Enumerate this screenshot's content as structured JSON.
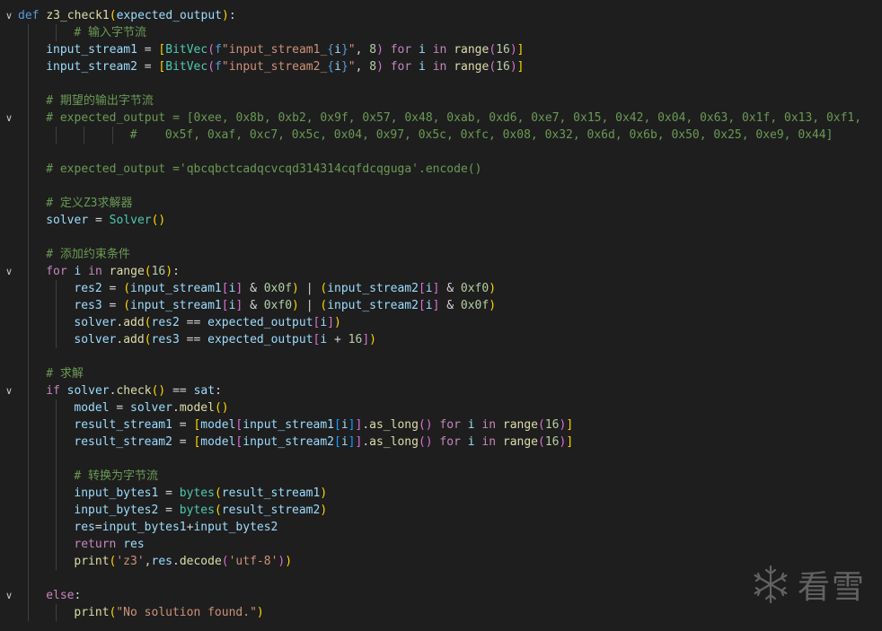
{
  "editor": {
    "language": "python",
    "theme_colors": {
      "background": "#1e1e1e",
      "keyword": "#569cd6",
      "control": "#c586c0",
      "function": "#dcdcaa",
      "class": "#4ec9b0",
      "variable": "#9cdcfe",
      "string": "#ce9178",
      "number": "#b5cea8",
      "comment": "#6a9955"
    },
    "lines": [
      {
        "fold": true,
        "guides": 0,
        "indent": 0,
        "tokens": [
          [
            "kw",
            "def "
          ],
          [
            "fn",
            "z3_check1"
          ],
          [
            "b1",
            "("
          ],
          [
            "var",
            "expected_output"
          ],
          [
            "b1",
            ")"
          ],
          [
            "op",
            ":"
          ]
        ]
      },
      {
        "fold": false,
        "guides": 2,
        "indent": 8,
        "tokens": [
          [
            "cmt",
            "# 输入字节流"
          ]
        ]
      },
      {
        "fold": false,
        "guides": 1,
        "indent": 4,
        "tokens": [
          [
            "var",
            "input_stream1"
          ],
          [
            "op",
            " = "
          ],
          [
            "b1",
            "["
          ],
          [
            "cls",
            "BitVec"
          ],
          [
            "b2",
            "("
          ],
          [
            "fstr",
            "f"
          ],
          [
            "str",
            "\"input_stream1_"
          ],
          [
            "kw",
            "{"
          ],
          [
            "var",
            "i"
          ],
          [
            "kw",
            "}"
          ],
          [
            "str",
            "\""
          ],
          [
            "op",
            ", "
          ],
          [
            "num",
            "8"
          ],
          [
            "b2",
            ")"
          ],
          [
            "ctl",
            " for "
          ],
          [
            "var",
            "i"
          ],
          [
            "ctl",
            " in "
          ],
          [
            "fn",
            "range"
          ],
          [
            "b2",
            "("
          ],
          [
            "num",
            "16"
          ],
          [
            "b2",
            ")"
          ],
          [
            "b1",
            "]"
          ]
        ]
      },
      {
        "fold": false,
        "guides": 1,
        "indent": 4,
        "tokens": [
          [
            "var",
            "input_stream2"
          ],
          [
            "op",
            " = "
          ],
          [
            "b1",
            "["
          ],
          [
            "cls",
            "BitVec"
          ],
          [
            "b2",
            "("
          ],
          [
            "fstr",
            "f"
          ],
          [
            "str",
            "\"input_stream2_"
          ],
          [
            "kw",
            "{"
          ],
          [
            "var",
            "i"
          ],
          [
            "kw",
            "}"
          ],
          [
            "str",
            "\""
          ],
          [
            "op",
            ", "
          ],
          [
            "num",
            "8"
          ],
          [
            "b2",
            ")"
          ],
          [
            "ctl",
            " for "
          ],
          [
            "var",
            "i"
          ],
          [
            "ctl",
            " in "
          ],
          [
            "fn",
            "range"
          ],
          [
            "b2",
            "("
          ],
          [
            "num",
            "16"
          ],
          [
            "b2",
            ")"
          ],
          [
            "b1",
            "]"
          ]
        ]
      },
      {
        "fold": false,
        "guides": 1,
        "indent": 0,
        "tokens": []
      },
      {
        "fold": false,
        "guides": 1,
        "indent": 4,
        "tokens": [
          [
            "cmt",
            "# 期望的输出字节流"
          ]
        ]
      },
      {
        "fold": true,
        "guides": 1,
        "indent": 4,
        "tokens": [
          [
            "cmt",
            "# expected_output = [0xee, 0x8b, 0xb2, 0x9f, 0x57, 0x48, 0xab, 0xd6, 0xe7, 0x15, 0x42, 0x04, 0x63, 0x1f, 0x13, 0xf1,"
          ]
        ]
      },
      {
        "fold": false,
        "guides": 4,
        "indent": 16,
        "tokens": [
          [
            "cmt",
            "#    0x5f, 0xaf, 0xc7, 0x5c, 0x04, 0x97, 0x5c, 0xfc, 0x08, 0x32, 0x6d, 0x6b, 0x50, 0x25, 0xe9, 0x44]"
          ]
        ]
      },
      {
        "fold": false,
        "guides": 1,
        "indent": 0,
        "tokens": []
      },
      {
        "fold": false,
        "guides": 1,
        "indent": 4,
        "tokens": [
          [
            "cmt",
            "# expected_output ='qbcqbctcadqcvcqd314314cqfdcqguga'.encode()"
          ]
        ]
      },
      {
        "fold": false,
        "guides": 1,
        "indent": 0,
        "tokens": []
      },
      {
        "fold": false,
        "guides": 1,
        "indent": 4,
        "tokens": [
          [
            "cmt",
            "# 定义Z3求解器"
          ]
        ]
      },
      {
        "fold": false,
        "guides": 1,
        "indent": 4,
        "tokens": [
          [
            "var",
            "solver"
          ],
          [
            "op",
            " = "
          ],
          [
            "cls",
            "Solver"
          ],
          [
            "b1",
            "()"
          ]
        ]
      },
      {
        "fold": false,
        "guides": 1,
        "indent": 0,
        "tokens": []
      },
      {
        "fold": false,
        "guides": 1,
        "indent": 4,
        "tokens": [
          [
            "cmt",
            "# 添加约束条件"
          ]
        ]
      },
      {
        "fold": true,
        "guides": 1,
        "indent": 4,
        "tokens": [
          [
            "ctl",
            "for "
          ],
          [
            "var",
            "i"
          ],
          [
            "ctl",
            " in "
          ],
          [
            "fn",
            "range"
          ],
          [
            "b1",
            "("
          ],
          [
            "num",
            "16"
          ],
          [
            "b1",
            ")"
          ],
          [
            "op",
            ":"
          ]
        ]
      },
      {
        "fold": false,
        "guides": 2,
        "indent": 8,
        "tokens": [
          [
            "var",
            "res2"
          ],
          [
            "op",
            " = "
          ],
          [
            "b1",
            "("
          ],
          [
            "var",
            "input_stream1"
          ],
          [
            "b2",
            "["
          ],
          [
            "var",
            "i"
          ],
          [
            "b2",
            "]"
          ],
          [
            "op",
            " & "
          ],
          [
            "num",
            "0x0f"
          ],
          [
            "b1",
            ")"
          ],
          [
            "op",
            " | "
          ],
          [
            "b1",
            "("
          ],
          [
            "var",
            "input_stream2"
          ],
          [
            "b2",
            "["
          ],
          [
            "var",
            "i"
          ],
          [
            "b2",
            "]"
          ],
          [
            "op",
            " & "
          ],
          [
            "num",
            "0xf0"
          ],
          [
            "b1",
            ")"
          ]
        ]
      },
      {
        "fold": false,
        "guides": 2,
        "indent": 8,
        "tokens": [
          [
            "var",
            "res3"
          ],
          [
            "op",
            " = "
          ],
          [
            "b1",
            "("
          ],
          [
            "var",
            "input_stream1"
          ],
          [
            "b2",
            "["
          ],
          [
            "var",
            "i"
          ],
          [
            "b2",
            "]"
          ],
          [
            "op",
            " & "
          ],
          [
            "num",
            "0xf0"
          ],
          [
            "b1",
            ")"
          ],
          [
            "op",
            " | "
          ],
          [
            "b1",
            "("
          ],
          [
            "var",
            "input_stream2"
          ],
          [
            "b2",
            "["
          ],
          [
            "var",
            "i"
          ],
          [
            "b2",
            "]"
          ],
          [
            "op",
            " & "
          ],
          [
            "num",
            "0x0f"
          ],
          [
            "b1",
            ")"
          ]
        ]
      },
      {
        "fold": false,
        "guides": 2,
        "indent": 8,
        "tokens": [
          [
            "var",
            "solver"
          ],
          [
            "op",
            "."
          ],
          [
            "fn",
            "add"
          ],
          [
            "b1",
            "("
          ],
          [
            "var",
            "res2"
          ],
          [
            "op",
            " == "
          ],
          [
            "var",
            "expected_output"
          ],
          [
            "b2",
            "["
          ],
          [
            "var",
            "i"
          ],
          [
            "b2",
            "]"
          ],
          [
            "b1",
            ")"
          ]
        ]
      },
      {
        "fold": false,
        "guides": 2,
        "indent": 8,
        "tokens": [
          [
            "var",
            "solver"
          ],
          [
            "op",
            "."
          ],
          [
            "fn",
            "add"
          ],
          [
            "b1",
            "("
          ],
          [
            "var",
            "res3"
          ],
          [
            "op",
            " == "
          ],
          [
            "var",
            "expected_output"
          ],
          [
            "b2",
            "["
          ],
          [
            "var",
            "i"
          ],
          [
            "op",
            " + "
          ],
          [
            "num",
            "16"
          ],
          [
            "b2",
            "]"
          ],
          [
            "b1",
            ")"
          ]
        ]
      },
      {
        "fold": false,
        "guides": 1,
        "indent": 0,
        "tokens": []
      },
      {
        "fold": false,
        "guides": 1,
        "indent": 4,
        "tokens": [
          [
            "cmt",
            "# 求解"
          ]
        ]
      },
      {
        "fold": true,
        "guides": 1,
        "indent": 4,
        "tokens": [
          [
            "ctl",
            "if "
          ],
          [
            "var",
            "solver"
          ],
          [
            "op",
            "."
          ],
          [
            "fn",
            "check"
          ],
          [
            "b1",
            "()"
          ],
          [
            "op",
            " == "
          ],
          [
            "var",
            "sat"
          ],
          [
            "op",
            ":"
          ]
        ]
      },
      {
        "fold": false,
        "guides": 2,
        "indent": 8,
        "tokens": [
          [
            "var",
            "model"
          ],
          [
            "op",
            " = "
          ],
          [
            "var",
            "solver"
          ],
          [
            "op",
            "."
          ],
          [
            "fn",
            "model"
          ],
          [
            "b1",
            "()"
          ]
        ]
      },
      {
        "fold": false,
        "guides": 2,
        "indent": 8,
        "tokens": [
          [
            "var",
            "result_stream1"
          ],
          [
            "op",
            " = "
          ],
          [
            "b1",
            "["
          ],
          [
            "var",
            "model"
          ],
          [
            "b2",
            "["
          ],
          [
            "var",
            "input_stream1"
          ],
          [
            "b3",
            "["
          ],
          [
            "var",
            "i"
          ],
          [
            "b3",
            "]"
          ],
          [
            "b2",
            "]"
          ],
          [
            "op",
            "."
          ],
          [
            "fn",
            "as_long"
          ],
          [
            "b2",
            "()"
          ],
          [
            "ctl",
            " for "
          ],
          [
            "var",
            "i"
          ],
          [
            "ctl",
            " in "
          ],
          [
            "fn",
            "range"
          ],
          [
            "b2",
            "("
          ],
          [
            "num",
            "16"
          ],
          [
            "b2",
            ")"
          ],
          [
            "b1",
            "]"
          ]
        ]
      },
      {
        "fold": false,
        "guides": 2,
        "indent": 8,
        "tokens": [
          [
            "var",
            "result_stream2"
          ],
          [
            "op",
            " = "
          ],
          [
            "b1",
            "["
          ],
          [
            "var",
            "model"
          ],
          [
            "b2",
            "["
          ],
          [
            "var",
            "input_stream2"
          ],
          [
            "b3",
            "["
          ],
          [
            "var",
            "i"
          ],
          [
            "b3",
            "]"
          ],
          [
            "b2",
            "]"
          ],
          [
            "op",
            "."
          ],
          [
            "fn",
            "as_long"
          ],
          [
            "b2",
            "()"
          ],
          [
            "ctl",
            " for "
          ],
          [
            "var",
            "i"
          ],
          [
            "ctl",
            " in "
          ],
          [
            "fn",
            "range"
          ],
          [
            "b2",
            "("
          ],
          [
            "num",
            "16"
          ],
          [
            "b2",
            ")"
          ],
          [
            "b1",
            "]"
          ]
        ]
      },
      {
        "fold": false,
        "guides": 2,
        "indent": 0,
        "tokens": []
      },
      {
        "fold": false,
        "guides": 2,
        "indent": 8,
        "tokens": [
          [
            "cmt",
            "# 转换为字节流"
          ]
        ]
      },
      {
        "fold": false,
        "guides": 2,
        "indent": 8,
        "tokens": [
          [
            "var",
            "input_bytes1"
          ],
          [
            "op",
            " = "
          ],
          [
            "cls",
            "bytes"
          ],
          [
            "b1",
            "("
          ],
          [
            "var",
            "result_stream1"
          ],
          [
            "b1",
            ")"
          ]
        ]
      },
      {
        "fold": false,
        "guides": 2,
        "indent": 8,
        "tokens": [
          [
            "var",
            "input_bytes2"
          ],
          [
            "op",
            " = "
          ],
          [
            "cls",
            "bytes"
          ],
          [
            "b1",
            "("
          ],
          [
            "var",
            "result_stream2"
          ],
          [
            "b1",
            ")"
          ]
        ]
      },
      {
        "fold": false,
        "guides": 2,
        "indent": 8,
        "tokens": [
          [
            "var",
            "res"
          ],
          [
            "op",
            "="
          ],
          [
            "var",
            "input_bytes1"
          ],
          [
            "op",
            "+"
          ],
          [
            "var",
            "input_bytes2"
          ]
        ]
      },
      {
        "fold": false,
        "guides": 2,
        "indent": 8,
        "tokens": [
          [
            "ctl",
            "return "
          ],
          [
            "var",
            "res"
          ]
        ]
      },
      {
        "fold": false,
        "guides": 2,
        "indent": 8,
        "tokens": [
          [
            "fn",
            "print"
          ],
          [
            "b1",
            "("
          ],
          [
            "str",
            "'z3'"
          ],
          [
            "op",
            ","
          ],
          [
            "var",
            "res"
          ],
          [
            "op",
            "."
          ],
          [
            "fn",
            "decode"
          ],
          [
            "b2",
            "("
          ],
          [
            "str",
            "'utf-8'"
          ],
          [
            "b2",
            ")"
          ],
          [
            "b1",
            ")"
          ]
        ]
      },
      {
        "fold": false,
        "guides": 1,
        "indent": 0,
        "tokens": []
      },
      {
        "fold": true,
        "guides": 1,
        "indent": 4,
        "tokens": [
          [
            "ctl",
            "else"
          ],
          [
            "op",
            ":"
          ]
        ]
      },
      {
        "fold": false,
        "guides": 2,
        "indent": 8,
        "tokens": [
          [
            "fn",
            "print"
          ],
          [
            "b1",
            "("
          ],
          [
            "str",
            "\"No solution found.\""
          ],
          [
            "b1",
            ")"
          ]
        ]
      }
    ]
  },
  "watermark": {
    "text": "看雪",
    "icon": "snowflake-icon"
  }
}
